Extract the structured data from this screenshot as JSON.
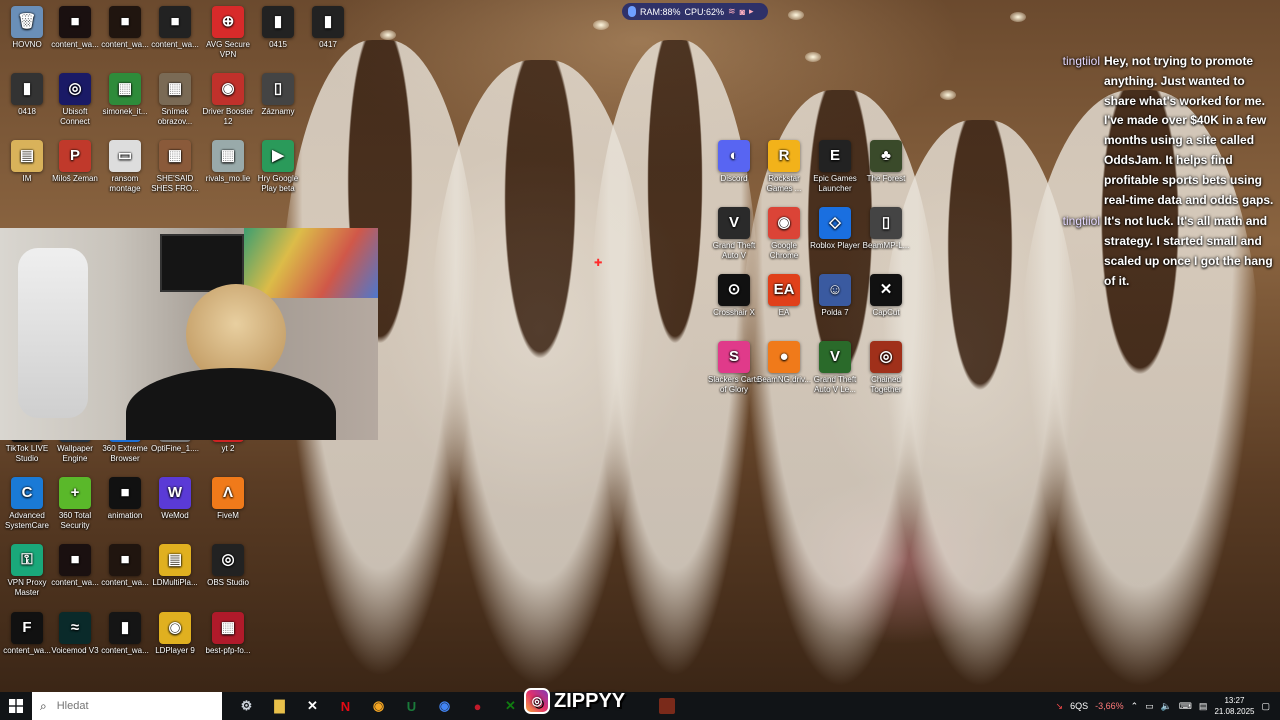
{
  "system_overlay": {
    "ram": "RAM:88%",
    "cpu": "CPU:62%"
  },
  "chat": [
    {
      "user": "tingtiiol",
      "text": "Hey, not trying to promote anything. Just wanted to share what's worked for me. I've made over $40K in a few months using a site called OddsJam. It helps find profitable sports bets using real-time data and odds gaps."
    },
    {
      "user": "tingtiiol",
      "text": "It's not luck. It's all math and strategy. I started small and scaled up once I got the hang of it."
    }
  ],
  "desktop_icons": [
    {
      "label": "HOVNO",
      "glyph": "🗑",
      "color": "#6a8fb8"
    },
    {
      "label": "content_wa...",
      "glyph": "■",
      "color": "#1a1010"
    },
    {
      "label": "content_wa...",
      "glyph": "■",
      "color": "#20150f"
    },
    {
      "label": "content_wa...",
      "glyph": "■",
      "color": "#222"
    },
    {
      "label": "AVG Secure VPN",
      "glyph": "⊕",
      "color": "#d82a2a"
    },
    {
      "label": "0415",
      "glyph": "▮",
      "color": "#222"
    },
    {
      "label": "0417",
      "glyph": "▮",
      "color": "#222"
    },
    {
      "label": "0418",
      "glyph": "▮",
      "color": "#333"
    },
    {
      "label": "Ubisoft Connect",
      "glyph": "◎",
      "color": "#1a1a66"
    },
    {
      "label": "simonek_it...",
      "glyph": "▦",
      "color": "#2e8b3a"
    },
    {
      "label": "Snímek obrazov...",
      "glyph": "▦",
      "color": "#7a6a55"
    },
    {
      "label": "Driver Booster 12",
      "glyph": "◉",
      "color": "#c0312b"
    },
    {
      "label": "Záznamy",
      "glyph": "▯",
      "color": "#444"
    },
    {
      "label": "IM",
      "glyph": "▤",
      "color": "#d9b25a"
    },
    {
      "label": "Miloš Zeman",
      "glyph": "P",
      "color": "#c0392b"
    },
    {
      "label": "ransom montage",
      "glyph": "▭",
      "color": "#ddd"
    },
    {
      "label": "SHE'SAID SHES FRO...",
      "glyph": "▦",
      "color": "#8a5a3a"
    },
    {
      "label": "rivals_mo.lie",
      "glyph": "▦",
      "color": "#9aa"
    },
    {
      "label": "Hry Google Play beta",
      "glyph": "▶",
      "color": "#2a9a5a"
    },
    {
      "label": "TikTok LIVE Studio",
      "glyph": "♪",
      "color": "#111"
    },
    {
      "label": "Wallpaper Engine",
      "glyph": "W",
      "color": "#234"
    },
    {
      "label": "360 Extreme Browser",
      "glyph": "e",
      "color": "#1c6fd6"
    },
    {
      "label": "OptiFine_1....",
      "glyph": "▦",
      "color": "#777"
    },
    {
      "label": "yt 2",
      "glyph": "▶",
      "color": "#c22"
    },
    {
      "label": "Advanced SystemCare",
      "glyph": "C",
      "color": "#1a7ad6"
    },
    {
      "label": "360 Total Security",
      "glyph": "+",
      "color": "#5ab82a"
    },
    {
      "label": "animation",
      "glyph": "■",
      "color": "#111"
    },
    {
      "label": "WeMod",
      "glyph": "W",
      "color": "#5a3ad6"
    },
    {
      "label": "FiveM",
      "glyph": "Λ",
      "color": "#f07a1a"
    },
    {
      "label": "VPN Proxy Master",
      "glyph": "⚿",
      "color": "#1aa87a"
    },
    {
      "label": "content_wa...",
      "glyph": "■",
      "color": "#1a1010"
    },
    {
      "label": "content_wa...",
      "glyph": "■",
      "color": "#20150f"
    },
    {
      "label": "LDMultiPla...",
      "glyph": "▤",
      "color": "#e0b020"
    },
    {
      "label": "OBS Studio",
      "glyph": "◎",
      "color": "#222"
    },
    {
      "label": "content_wa...",
      "glyph": "F",
      "color": "#111"
    },
    {
      "label": "Voicemod V3",
      "glyph": "≈",
      "color": "#0a2a2a"
    },
    {
      "label": "content_wa...",
      "glyph": "▮",
      "color": "#151515"
    },
    {
      "label": "LDPlayer 9",
      "glyph": "◉",
      "color": "#e0b020"
    },
    {
      "label": "best-pfp-fo...",
      "glyph": "▦",
      "color": "#b01a2a"
    },
    {
      "label": "Discord",
      "glyph": "◐",
      "color": "#5865f2"
    },
    {
      "label": "Rockstar Games ...",
      "glyph": "R",
      "color": "#f2b21a"
    },
    {
      "label": "Epic Games Launcher",
      "glyph": "E",
      "color": "#222"
    },
    {
      "label": "The Forest",
      "glyph": "♣",
      "color": "#3a4a2a"
    },
    {
      "label": "Grand Theft Auto V",
      "glyph": "V",
      "color": "#2a2a2a"
    },
    {
      "label": "Google Chrome",
      "glyph": "◉",
      "color": "#db4437"
    },
    {
      "label": "Roblox Player",
      "glyph": "◇",
      "color": "#1a6fe0"
    },
    {
      "label": "BeamMP-L...",
      "glyph": "▯",
      "color": "#444"
    },
    {
      "label": "Crosshair X",
      "glyph": "⊙",
      "color": "#111"
    },
    {
      "label": "EA",
      "glyph": "EA",
      "color": "#e0401a"
    },
    {
      "label": "Polda 7",
      "glyph": "☺",
      "color": "#3a5aa0"
    },
    {
      "label": "CapCut",
      "glyph": "✕",
      "color": "#111"
    },
    {
      "label": "Slackers Carts of Glory",
      "glyph": "S",
      "color": "#e03a8a"
    },
    {
      "label": "BeamNG.driv...",
      "glyph": "●",
      "color": "#f07a1a"
    },
    {
      "label": "Grand Theft Auto V Le...",
      "glyph": "V",
      "color": "#2a6a2a"
    },
    {
      "label": "Chained Together",
      "glyph": "◎",
      "color": "#a0301a"
    }
  ],
  "taskbar": {
    "search_placeholder": "Hledat",
    "apps": [
      {
        "name": "settings-app",
        "glyph": "⚙",
        "color": "#cfd6de"
      },
      {
        "name": "file-explorer-app",
        "glyph": "▇",
        "color": "#e8c04a"
      },
      {
        "name": "capcut-app",
        "glyph": "✕",
        "color": "#ffffff"
      },
      {
        "name": "netflix-app",
        "glyph": "N",
        "color": "#e50914"
      },
      {
        "name": "photos-app",
        "glyph": "◉",
        "color": "#f5a623"
      },
      {
        "name": "upwork-app",
        "glyph": "U",
        "color": "#1a7a3a"
      },
      {
        "name": "chrome-app",
        "glyph": "◉",
        "color": "#4285f4"
      },
      {
        "name": "record-app",
        "glyph": "●",
        "color": "#c21a2a"
      },
      {
        "name": "xbox-app",
        "glyph": "✕",
        "color": "#107c10"
      }
    ],
    "overlay_brand": "ZIPPYY",
    "tray": {
      "ticker": "6QS",
      "change": "-3,66%",
      "time": "13:27",
      "date": "21.08.2025"
    }
  }
}
